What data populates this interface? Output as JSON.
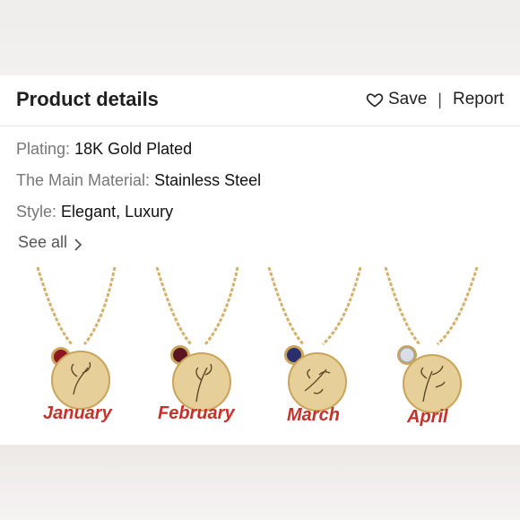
{
  "header": {
    "title": "Product details",
    "save_label": "Save",
    "separator": "|",
    "report_label": "Report"
  },
  "details": [
    {
      "key": "Plating:",
      "value": "18K Gold Plated"
    },
    {
      "key": "The Main Material:",
      "value": "Stainless Steel"
    },
    {
      "key": "Style:",
      "value": "Elegant, Luxury"
    }
  ],
  "see_all_label": "See all",
  "necklaces": [
    {
      "month": "January",
      "stone_color": "#8e1620"
    },
    {
      "month": "February",
      "stone_color": "#5a1420"
    },
    {
      "month": "March",
      "stone_color": "#2c2f6e"
    },
    {
      "month": "April",
      "stone_color": "#d9dde4"
    }
  ],
  "colors": {
    "month_text": "#c8302a",
    "gold": "#d4b06a"
  }
}
